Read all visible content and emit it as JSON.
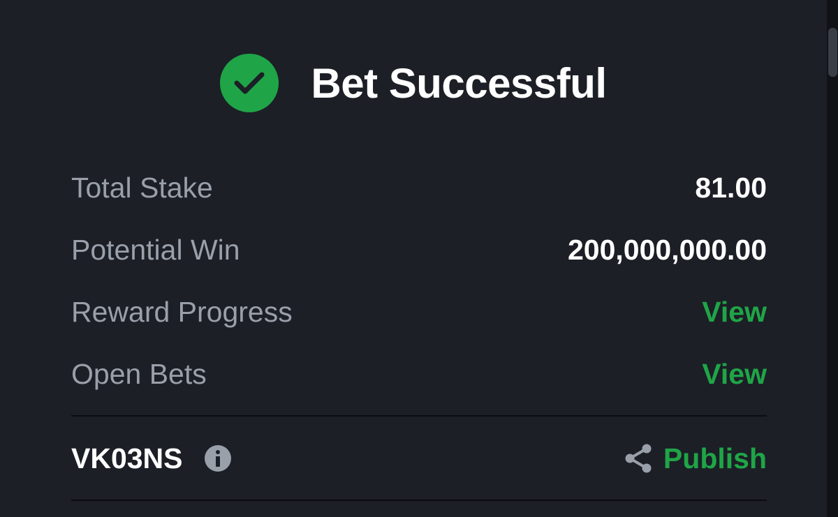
{
  "header": {
    "title": "Bet Successful",
    "status_icon": "check-circle-icon",
    "accent_color": "#1fa547"
  },
  "summary": {
    "rows": [
      {
        "label": "Total Stake",
        "value": "81.00"
      },
      {
        "label": "Potential Win",
        "value": "200,000,000.00"
      },
      {
        "label": "Reward Progress",
        "value": "View"
      },
      {
        "label": "Open Bets",
        "value": "View"
      }
    ]
  },
  "booking": {
    "code": "VK03NS",
    "info_icon": "info-icon",
    "share_icon": "share-icon",
    "publish_label": "Publish"
  },
  "colors": {
    "background": "#1c1f26",
    "label": "#9aa0aa",
    "value": "#ffffff",
    "link": "#1fa547"
  }
}
